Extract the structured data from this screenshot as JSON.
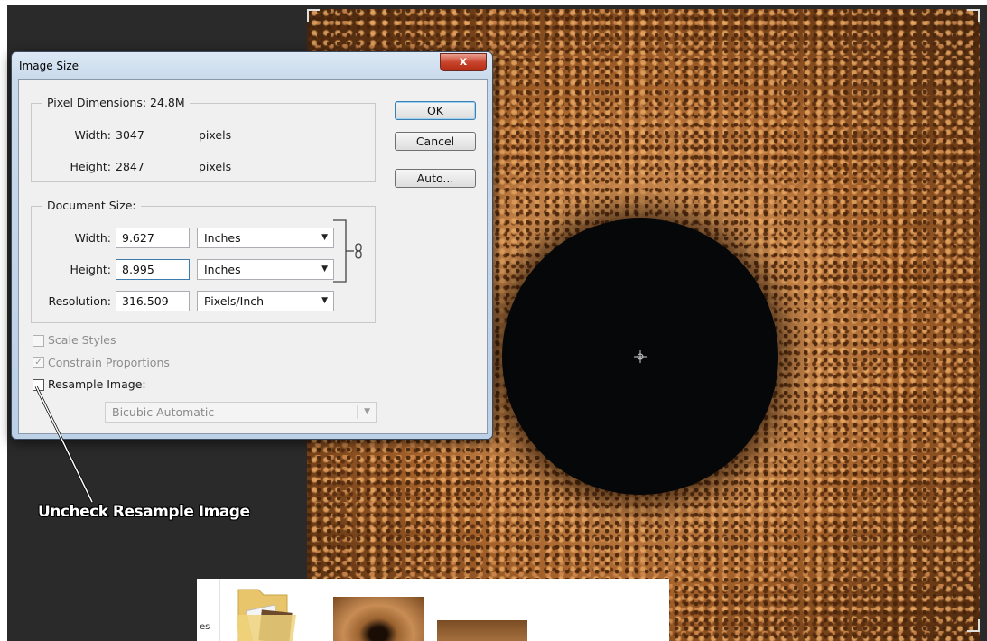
{
  "dialog": {
    "title": "Image Size",
    "close_label": "x",
    "pixel_dimensions": {
      "legend": "Pixel Dimensions:",
      "size": "24.8M",
      "width_label": "Width:",
      "width_value": "3047",
      "width_unit": "pixels",
      "height_label": "Height:",
      "height_value": "2847",
      "height_unit": "pixels"
    },
    "document_size": {
      "legend": "Document Size:",
      "width_label": "Width:",
      "width_value": "9.627",
      "width_unit": "Inches",
      "height_label": "Height:",
      "height_value": "8.995",
      "height_unit": "Inches",
      "resolution_label": "Resolution:",
      "resolution_value": "316.509",
      "resolution_unit": "Pixels/Inch"
    },
    "buttons": {
      "ok": "OK",
      "cancel": "Cancel",
      "auto": "Auto..."
    },
    "options": {
      "scale_styles": {
        "label": "Scale Styles",
        "checked": false,
        "enabled": false
      },
      "constrain_proportions": {
        "label": "Constrain Proportions",
        "checked": true,
        "enabled": false
      },
      "resample_image": {
        "label": "Resample Image:",
        "checked": false,
        "enabled": true
      },
      "resample_method": "Bicubic Automatic"
    }
  },
  "annotation": {
    "text": "Uncheck Resample Image"
  },
  "explorer": {
    "partial_label": "es"
  },
  "colors": {
    "workspace": "#2a2a2a",
    "dialog_frame": "#c9daec",
    "close_button": "#c9442c",
    "hole": "#060708"
  }
}
